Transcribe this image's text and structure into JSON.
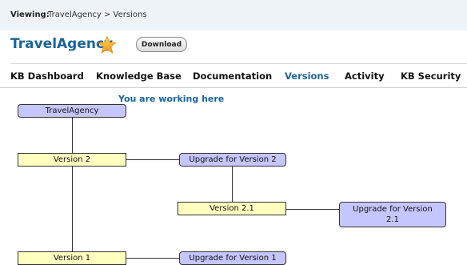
{
  "breadcrumb": {
    "label": "Viewing:",
    "path": "TravelAgency > Versions"
  },
  "header": {
    "title": "TravelAgency",
    "download_label": "Download"
  },
  "tabs": [
    {
      "label": "KB Dashboard",
      "active": false
    },
    {
      "label": "Knowledge Base",
      "active": false
    },
    {
      "label": "Documentation",
      "active": false
    },
    {
      "label": "Versions",
      "active": true
    },
    {
      "label": "Activity",
      "active": false
    },
    {
      "label": "KB Security",
      "active": false
    }
  ],
  "tree": {
    "working_here": "You are working here",
    "root": "TravelAgency",
    "version_2": "Version 2",
    "upgrade_v2": "Upgrade for Version 2",
    "version_2_1": "Version 2.1",
    "upgrade_v2_1": "Upgrade for Version 2.1",
    "version_1": "Version 1",
    "upgrade_v1": "Upgrade for Version 1"
  },
  "colors": {
    "accent": "#1a6496",
    "version_fill": "#ffffc0",
    "kb_fill": "#c6c6ff",
    "star": "#f5a623"
  }
}
